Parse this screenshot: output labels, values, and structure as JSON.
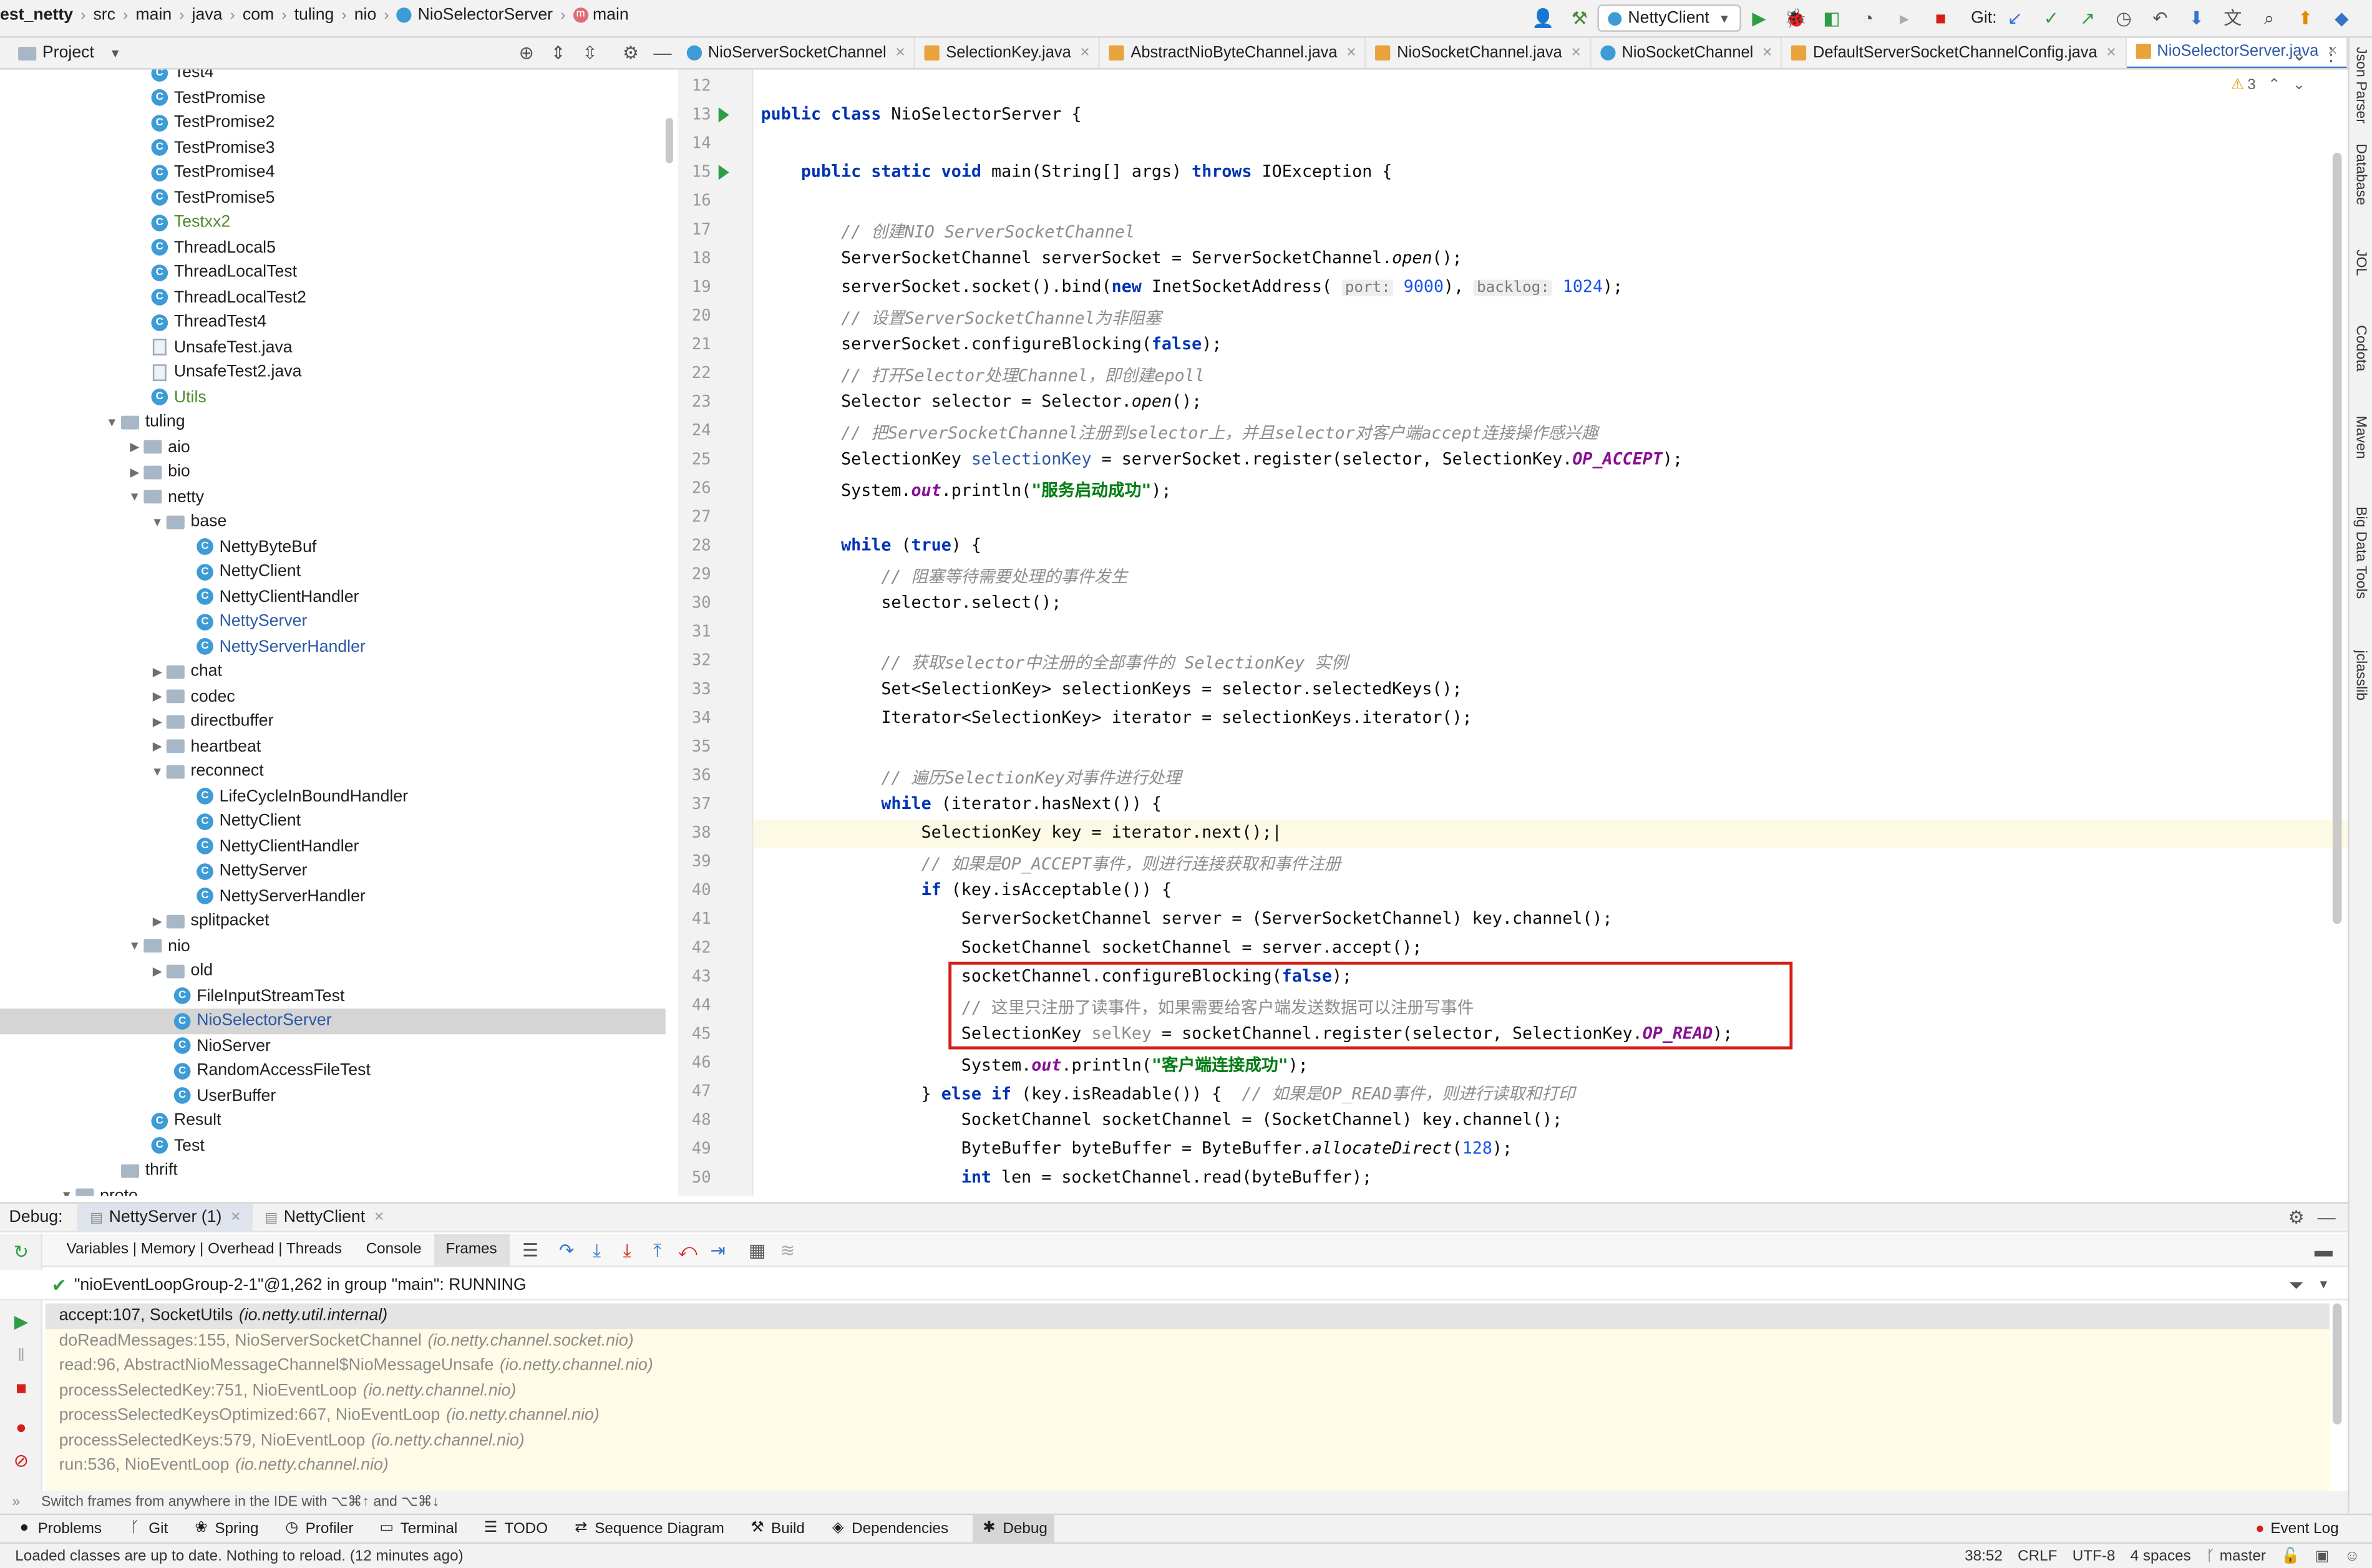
{
  "breadcrumbs": [
    {
      "label": "est_netty",
      "bold": true
    },
    {
      "label": "src"
    },
    {
      "label": "main"
    },
    {
      "label": "java"
    },
    {
      "label": "com"
    },
    {
      "label": "tuling"
    },
    {
      "label": "nio"
    },
    {
      "label": "NioSelectorServer"
    },
    {
      "label": "main"
    }
  ],
  "toolbar": {
    "run_config": "NettyClient",
    "git_label": "Git:"
  },
  "project": {
    "title": "Project"
  },
  "tree": [
    {
      "label": "Test4",
      "depth": 7,
      "kind": "class"
    },
    {
      "label": "TestPromise",
      "depth": 7,
      "kind": "class"
    },
    {
      "label": "TestPromise2",
      "depth": 7,
      "kind": "class"
    },
    {
      "label": "TestPromise3",
      "depth": 7,
      "kind": "class"
    },
    {
      "label": "TestPromise4",
      "depth": 7,
      "kind": "class"
    },
    {
      "label": "TestPromise5",
      "depth": 7,
      "kind": "class"
    },
    {
      "label": "Testxx2",
      "depth": 7,
      "kind": "class",
      "color": "#508a2a"
    },
    {
      "label": "ThreadLocal5",
      "depth": 7,
      "kind": "class"
    },
    {
      "label": "ThreadLocalTest",
      "depth": 7,
      "kind": "class"
    },
    {
      "label": "ThreadLocalTest2",
      "depth": 7,
      "kind": "class"
    },
    {
      "label": "ThreadTest4",
      "depth": 7,
      "kind": "class"
    },
    {
      "label": "UnsafeTest.java",
      "depth": 7,
      "kind": "file"
    },
    {
      "label": "UnsafeTest2.java",
      "depth": 7,
      "kind": "file"
    },
    {
      "label": "Utils",
      "depth": 7,
      "kind": "class",
      "color": "#508a2a"
    },
    {
      "label": "tuling",
      "depth": 5,
      "kind": "folder",
      "arrow": "open"
    },
    {
      "label": "aio",
      "depth": 6,
      "kind": "folder",
      "arrow": "closed"
    },
    {
      "label": "bio",
      "depth": 6,
      "kind": "folder",
      "arrow": "closed"
    },
    {
      "label": "netty",
      "depth": 6,
      "kind": "folder",
      "arrow": "open"
    },
    {
      "label": "base",
      "depth": 7,
      "kind": "folder",
      "arrow": "open"
    },
    {
      "label": "NettyByteBuf",
      "depth": 9,
      "kind": "class"
    },
    {
      "label": "NettyClient",
      "depth": 9,
      "kind": "class"
    },
    {
      "label": "NettyClientHandler",
      "depth": 9,
      "kind": "class"
    },
    {
      "label": "NettyServer",
      "depth": 9,
      "kind": "class",
      "color": "#2a58a6"
    },
    {
      "label": "NettyServerHandler",
      "depth": 9,
      "kind": "class",
      "color": "#2a58a6"
    },
    {
      "label": "chat",
      "depth": 7,
      "kind": "folder",
      "arrow": "closed"
    },
    {
      "label": "codec",
      "depth": 7,
      "kind": "folder",
      "arrow": "closed"
    },
    {
      "label": "directbuffer",
      "depth": 7,
      "kind": "folder",
      "arrow": "closed"
    },
    {
      "label": "heartbeat",
      "depth": 7,
      "kind": "folder",
      "arrow": "closed"
    },
    {
      "label": "reconnect",
      "depth": 7,
      "kind": "folder",
      "arrow": "open"
    },
    {
      "label": "LifeCycleInBoundHandler",
      "depth": 9,
      "kind": "class"
    },
    {
      "label": "NettyClient",
      "depth": 9,
      "kind": "class"
    },
    {
      "label": "NettyClientHandler",
      "depth": 9,
      "kind": "class"
    },
    {
      "label": "NettyServer",
      "depth": 9,
      "kind": "class"
    },
    {
      "label": "NettyServerHandler",
      "depth": 9,
      "kind": "class"
    },
    {
      "label": "splitpacket",
      "depth": 7,
      "kind": "folder",
      "arrow": "closed"
    },
    {
      "label": "nio",
      "depth": 6,
      "kind": "folder",
      "arrow": "open"
    },
    {
      "label": "old",
      "depth": 7,
      "kind": "folder",
      "arrow": "closed"
    },
    {
      "label": "FileInputStreamTest",
      "depth": 8,
      "kind": "class"
    },
    {
      "label": "NioSelectorServer",
      "depth": 8,
      "kind": "class",
      "selected": true,
      "color": "#2a58a6"
    },
    {
      "label": "NioServer",
      "depth": 8,
      "kind": "class"
    },
    {
      "label": "RandomAccessFileTest",
      "depth": 8,
      "kind": "class"
    },
    {
      "label": "UserBuffer",
      "depth": 8,
      "kind": "class"
    },
    {
      "label": "Result",
      "depth": 7,
      "kind": "class"
    },
    {
      "label": "Test",
      "depth": 7,
      "kind": "class"
    },
    {
      "label": "thrift",
      "depth": 5,
      "kind": "folder"
    },
    {
      "label": "proto",
      "depth": 4,
      "kind": "folder",
      "arrow": "open"
    }
  ],
  "tabs": [
    {
      "label": "NioServerSocketChannel"
    },
    {
      "label": "SelectionKey.java"
    },
    {
      "label": "AbstractNioByteChannel.java"
    },
    {
      "label": "NioSocketChannel.java"
    },
    {
      "label": "NioSocketChannel"
    },
    {
      "label": "DefaultServerSocketChannelConfig.java"
    },
    {
      "label": "NioSelectorServer.java",
      "active": true
    }
  ],
  "warnings": "3",
  "code_lines": [
    {
      "n": "12",
      "html": ""
    },
    {
      "n": "13",
      "run": true,
      "html": "<span class='kw'>public class</span> NioSelectorServer {"
    },
    {
      "n": "14",
      "html": ""
    },
    {
      "n": "15",
      "run": true,
      "html": "    <span class='kw'>public static void</span> main(String[] args) <span class='kw'>throws</span> IOException {"
    },
    {
      "n": "16",
      "html": ""
    },
    {
      "n": "17",
      "html": "        <span class='cm'>// 创建NIO ServerSocketChannel</span>"
    },
    {
      "n": "18",
      "html": "        ServerSocketChannel serverSocket = ServerSocketChannel.<span class='it'>open</span>();"
    },
    {
      "n": "19",
      "html": "        serverSocket.socket().bind(<span class='kw'>new</span> InetSocketAddress( <span class='hint'>port:</span> <span class='num'>9000</span>), <span class='hint'>backlog:</span> <span class='num'>1024</span>);"
    },
    {
      "n": "20",
      "html": "        <span class='cm'>// 设置ServerSocketChannel为非阻塞</span>"
    },
    {
      "n": "21",
      "html": "        serverSocket.configureBlocking(<span class='kw'>false</span>);"
    },
    {
      "n": "22",
      "html": "        <span class='cm'>// 打开Selector处理Channel，即创建epoll</span>"
    },
    {
      "n": "23",
      "html": "        Selector selector = Selector.<span class='it'>open</span>();"
    },
    {
      "n": "24",
      "html": "        <span class='cm'>// 把ServerSocketChannel注册到selector上，并且selector对客户端accept连接操作感兴趣</span>"
    },
    {
      "n": "25",
      "html": "        SelectionKey <span style='color:#2a58a6'>selectionKey</span> = serverSocket.register(selector, SelectionKey.<span class='fld'>OP_ACCEPT</span>);"
    },
    {
      "n": "26",
      "html": "        System.<span class='fld'>out</span>.println(<span class='str'>\"服务启动成功\"</span>);"
    },
    {
      "n": "27",
      "html": ""
    },
    {
      "n": "28",
      "html": "        <span class='kw'>while</span> (<span class='kw'>true</span>) {"
    },
    {
      "n": "29",
      "html": "            <span class='cm'>// 阻塞等待需要处理的事件发生</span>"
    },
    {
      "n": "30",
      "html": "            selector.select();"
    },
    {
      "n": "31",
      "html": ""
    },
    {
      "n": "32",
      "html": "            <span class='cm'>// 获取selector中注册的全部事件的 SelectionKey 实例</span>"
    },
    {
      "n": "33",
      "html": "            Set&lt;SelectionKey&gt; selectionKeys = selector.selectedKeys();"
    },
    {
      "n": "34",
      "html": "            Iterator&lt;SelectionKey&gt; iterator = selectionKeys.iterator();"
    },
    {
      "n": "35",
      "html": ""
    },
    {
      "n": "36",
      "html": "            <span class='cm'>// 遍历SelectionKey对事件进行处理</span>"
    },
    {
      "n": "37",
      "html": "            <span class='kw'>while</span> (iterator.hasNext()) {"
    },
    {
      "n": "38",
      "cur": true,
      "html": "                SelectionKey key = iterator.next();|"
    },
    {
      "n": "39",
      "html": "                <span class='cm'>// 如果是OP_ACCEPT事件，则进行连接获取和事件注册</span>"
    },
    {
      "n": "40",
      "html": "                <span class='kw'>if</span> (key.isAcceptable()) {"
    },
    {
      "n": "41",
      "html": "                    ServerSocketChannel server = (ServerSocketChannel) key.channel();"
    },
    {
      "n": "42",
      "html": "                    SocketChannel socketChannel = server.accept();"
    },
    {
      "n": "43",
      "html": "                    socketChannel.configureBlocking(<span class='kw'>false</span>);"
    },
    {
      "n": "44",
      "html": "                    <span class='cm' style='font-style:normal'>// 这里只注册了读事件，如果需要给客户端发送数据可以注册写事件</span>"
    },
    {
      "n": "45",
      "html": "                    SelectionKey <span style='color:#8c8c8c'>selKey</span> = socketChannel.register(selector, SelectionKey.<span class='fld'>OP_READ</span>);"
    },
    {
      "n": "46",
      "html": "                    System.<span class='fld'>out</span>.println(<span class='str'>\"客户端连接成功\"</span>);"
    },
    {
      "n": "47",
      "html": "                } <span class='kw'>else if</span> (key.isReadable()) {  <span class='cm'>// 如果是OP_READ事件，则进行读取和打印</span>"
    },
    {
      "n": "48",
      "html": "                    SocketChannel socketChannel = (SocketChannel) key.channel();"
    },
    {
      "n": "49",
      "html": "                    ByteBuffer byteBuffer = ByteBuffer.<span class='it'>allocateDirect</span>(<span class='num'>128</span>);"
    },
    {
      "n": "50",
      "html": "                    <span class='kw'>int</span> len = socketChannel.read(byteBuffer);"
    }
  ],
  "right_sidebar": [
    "Json Parser",
    "Database",
    "JOL",
    "Codota",
    "Maven",
    "Big Data Tools",
    "jclasslib"
  ],
  "debug": {
    "label": "Debug:",
    "sessions": [
      {
        "label": "NettyServer (1)",
        "active": true
      },
      {
        "label": "NettyClient"
      }
    ],
    "tabs": [
      "Variables | Memory | Overhead | Threads",
      "Console",
      "Frames"
    ],
    "thread": "\"nioEventLoopGroup-2-1\"@1,262 in group \"main\": RUNNING",
    "frames": [
      {
        "method": "accept:107, SocketUtils",
        "pkg": "(io.netty.util.internal)",
        "current": true
      },
      {
        "method": "doReadMessages:155, NioServerSocketChannel",
        "pkg": "(io.netty.channel.socket.nio)"
      },
      {
        "method": "read:96, AbstractNioMessageChannel$NioMessageUnsafe",
        "pkg": "(io.netty.channel.nio)"
      },
      {
        "method": "processSelectedKey:751, NioEventLoop",
        "pkg": "(io.netty.channel.nio)"
      },
      {
        "method": "processSelectedKeysOptimized:667, NioEventLoop",
        "pkg": "(io.netty.channel.nio)"
      },
      {
        "method": "processSelectedKeys:579, NioEventLoop",
        "pkg": "(io.netty.channel.nio)"
      },
      {
        "method": "run:536, NioEventLoop",
        "pkg": "(io.netty.channel.nio)"
      }
    ],
    "hint": "Switch frames from anywhere in the IDE with ⌥⌘↑ and ⌥⌘↓"
  },
  "tool_windows": [
    {
      "label": "Problems",
      "icon": "●"
    },
    {
      "label": "Git",
      "icon": "ᚴ"
    },
    {
      "label": "Spring",
      "icon": "❀"
    },
    {
      "label": "Profiler",
      "icon": "◷"
    },
    {
      "label": "Terminal",
      "icon": "▭"
    },
    {
      "label": "TODO",
      "icon": "☰"
    },
    {
      "label": "Sequence Diagram",
      "icon": "⇄"
    },
    {
      "label": "Build",
      "icon": "⚒"
    },
    {
      "label": "Dependencies",
      "icon": "◈"
    },
    {
      "label": "Debug",
      "icon": "✱",
      "active": true
    }
  ],
  "event_log": "Event Log",
  "status": {
    "message": "Loaded classes are up to date. Nothing to reload. (12 minutes ago)",
    "position": "38:52",
    "line_sep": "CRLF",
    "encoding": "UTF-8",
    "indent": "4 spaces",
    "branch": "master"
  }
}
